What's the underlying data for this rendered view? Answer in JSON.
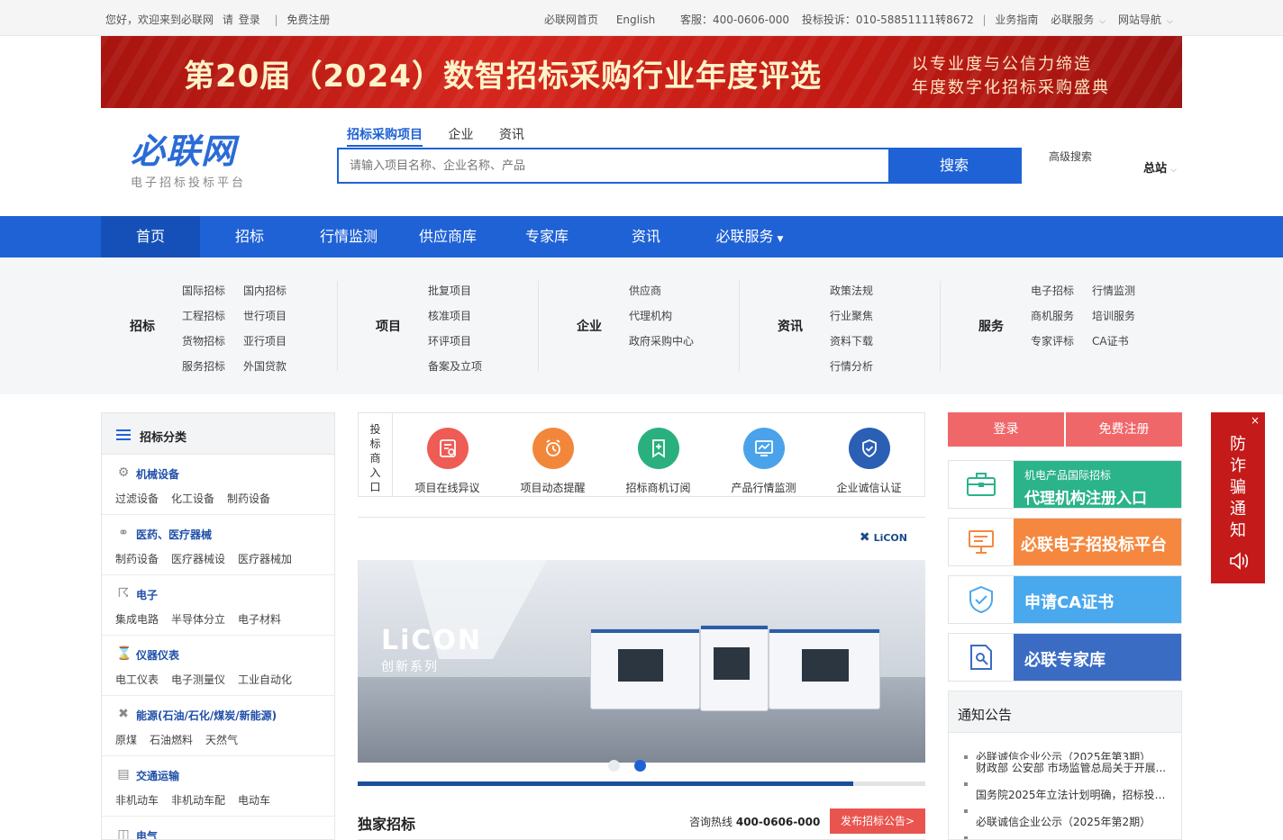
{
  "topbar": {
    "greeting": "您好，欢迎来到必联网",
    "please": "请",
    "login": "登录",
    "sep": "|",
    "register": "免费注册",
    "home": "必联网首页",
    "english": "English",
    "service": "客服：400-0606-000",
    "complaint": "投标投诉：010-58851111转8672",
    "guide": "业务指南",
    "bl_service": "必联服务",
    "site_nav": "网站导航"
  },
  "banner": {
    "title": "第20届（2024）数智招标采购行业年度评选",
    "sub1": "以专业度与公信力缔造",
    "sub2": "年度数字化招标采购盛典"
  },
  "logo": {
    "main": "必联网",
    "sub": "电子招标投标平台"
  },
  "search": {
    "tabs": [
      "招标采购项目",
      "企业",
      "资讯"
    ],
    "placeholder": "请输入项目名称、企业名称、产品",
    "button": "搜索",
    "advanced": "高级搜索",
    "station": "总站"
  },
  "nav": [
    "首页",
    "招标",
    "行情监测",
    "供应商库",
    "专家库",
    "资讯",
    "必联服务"
  ],
  "categories": [
    {
      "title": "招标",
      "items": [
        "国际招标",
        "国内招标",
        "工程招标",
        "世行项目",
        "货物招标",
        "亚行项目",
        "服务招标",
        "外国贷款"
      ]
    },
    {
      "title": "项目",
      "items": [
        "批复项目",
        "核准项目",
        "环评项目",
        "备案及立项"
      ]
    },
    {
      "title": "企业",
      "items": [
        "供应商",
        "代理机构",
        "政府采购中心"
      ]
    },
    {
      "title": "资讯",
      "items": [
        "政策法规",
        "行业聚焦",
        "资料下载",
        "行情分析"
      ]
    },
    {
      "title": "服务",
      "items": [
        "电子招标",
        "行情监测",
        "商机服务",
        "培训服务",
        "专家评标",
        "CA证书"
      ]
    }
  ],
  "sidebar": {
    "title": "招标分类",
    "cats": [
      {
        "name": "机械设备",
        "subs": [
          "过滤设备",
          "化工设备",
          "制药设备"
        ]
      },
      {
        "name": "医药、医疗器械",
        "subs": [
          "制药设备",
          "医疗器械设",
          "医疗器械加"
        ]
      },
      {
        "name": "电子",
        "subs": [
          "集成电路",
          "半导体分立",
          "电子材料"
        ]
      },
      {
        "name": "仪器仪表",
        "subs": [
          "电工仪表",
          "电子测量仪",
          "工业自动化"
        ]
      },
      {
        "name": "能源(石油/石化/煤炭/新能源)",
        "subs": [
          "原煤",
          "石油燃料",
          "天然气"
        ]
      },
      {
        "name": "交通运输",
        "subs": [
          "非机动车",
          "非机动车配",
          "电动车"
        ]
      },
      {
        "name": "电气",
        "subs": []
      }
    ]
  },
  "entry": {
    "label": [
      "投",
      "标",
      "商",
      "入",
      "口"
    ],
    "items": [
      {
        "label": "项目在线异议",
        "color": "#ef5b55",
        "icon": "objection-icon"
      },
      {
        "label": "项目动态提醒",
        "color": "#f2873c",
        "icon": "alarm-clock-icon"
      },
      {
        "label": "招标商机订阅",
        "color": "#2ab07f",
        "icon": "subscribe-icon"
      },
      {
        "label": "产品行情监测",
        "color": "#4aa3ea",
        "icon": "monitor-icon"
      },
      {
        "label": "企业诚信认证",
        "color": "#2a5fb4",
        "icon": "shield-check-icon"
      }
    ]
  },
  "slider": {
    "brand": "LiCON",
    "headline": "LiCON",
    "series": "创新系列"
  },
  "exclusive": {
    "title": "独家招标",
    "hotline_label": "咨询热线",
    "hotline": "400-0606-000",
    "button": "发布招标公告>"
  },
  "right": {
    "login": "登录",
    "register": "免费注册",
    "cards": [
      {
        "line1": "机电产品国际招标",
        "line2": "代理机构注册入口",
        "color": "#2bb38a"
      },
      {
        "line1": "",
        "line2": "必联电子招投标平台",
        "color": "#f5883e"
      },
      {
        "line1": "",
        "line2": "申请CA证书",
        "color": "#4aa8ec"
      },
      {
        "line1": "",
        "line2": "必联专家库",
        "color": "#3a6cc4"
      }
    ],
    "notice_title": "通知公告",
    "notices": [
      "必联诚信企业公示（2025年第3期）",
      "财政部 公安部 市场监管总局关于开展...",
      "国务院2025年立法计划明确，招标投标...",
      "必联诚信企业公示（2025年第2期）"
    ]
  },
  "fraud": {
    "text": [
      "防",
      "诈",
      "骗",
      "通",
      "知"
    ],
    "close": "×"
  },
  "colors": {
    "primary": "#1f62d6",
    "nav_active": "#1450b8",
    "banner_red": "#c11a13",
    "fraud_red": "#c51a1a"
  }
}
